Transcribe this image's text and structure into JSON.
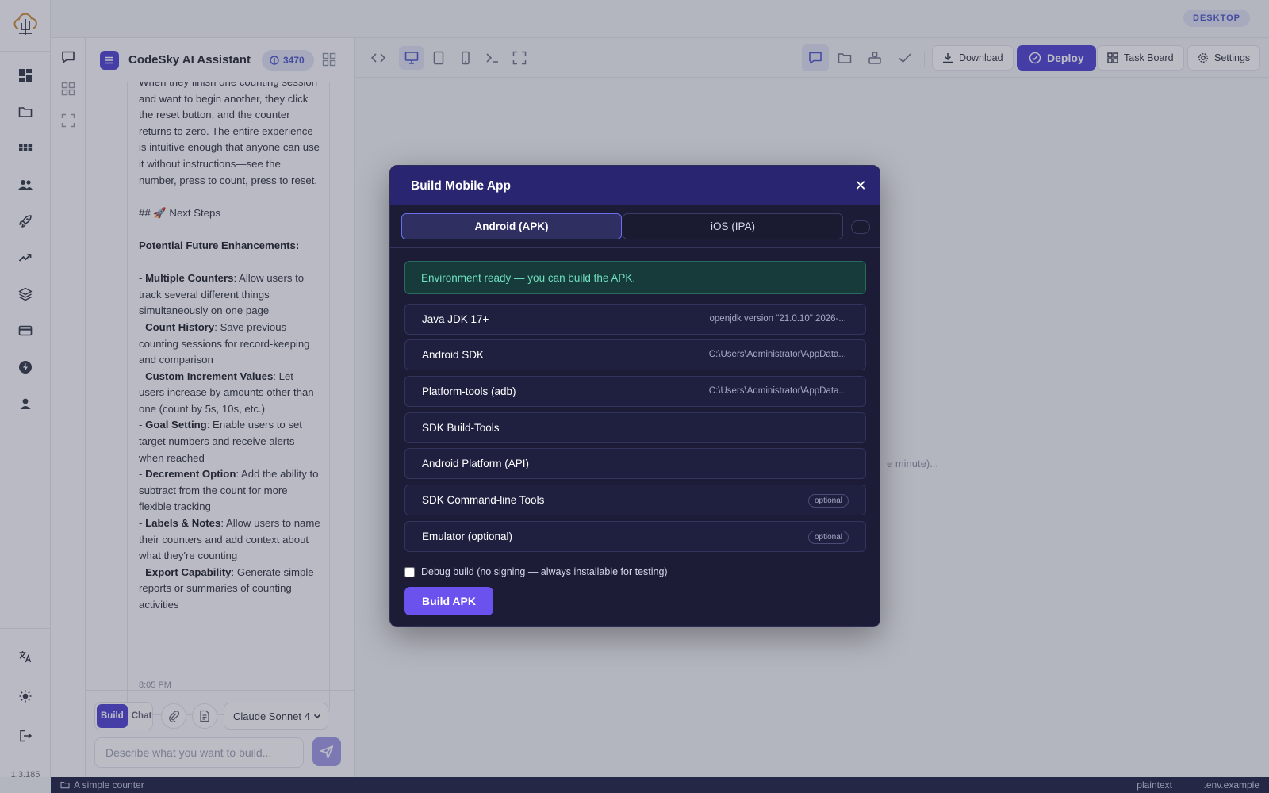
{
  "app": {
    "version": "1.3.185",
    "view_mode_pill": "DESKTOP"
  },
  "rail": {
    "icons": [
      "dashboard-icon",
      "folder-icon",
      "apps-grid-icon",
      "users-icon",
      "rocket-icon",
      "trending-icon",
      "layers-icon",
      "billing-card-icon",
      "bolt-icon",
      "profile-icon",
      "translate-icon",
      "theme-sun-icon",
      "logout-icon"
    ]
  },
  "chat": {
    "title": "CodeSky AI Assistant",
    "credits": "3470",
    "message": {
      "p1": "When they finish one counting session and want to begin another, they click the reset button, and the counter returns to zero. The entire experience is intuitive enough that anyone can use it without instructions—see the number, press to count, press to reset.",
      "heading": "## 🚀 Next Steps",
      "subheading": "Potential Future Enhancements:",
      "items": [
        {
          "title": "Multiple Counters",
          "text": ": Allow users to track several different things simultaneously on one page"
        },
        {
          "title": "Count History",
          "text": ": Save previous counting sessions for record-keeping and comparison"
        },
        {
          "title": "Custom Increment Values",
          "text": ": Let users increase by amounts other than one (count by 5s, 10s, etc.)"
        },
        {
          "title": "Goal Setting",
          "text": ": Enable users to set target numbers and receive alerts when reached"
        },
        {
          "title": "Decrement Option",
          "text": ": Add the ability to subtract from the count for more flexible tracking"
        },
        {
          "title": "Labels & Notes",
          "text": ": Allow users to name their counters and add context about what they're counting"
        },
        {
          "title": "Export Capability",
          "text": ": Generate simple reports or summaries of counting activities"
        }
      ],
      "time": "8:05 PM"
    },
    "composer": {
      "mode_build": "Build",
      "mode_chat": "Chat",
      "model": "Claude Sonnet 4",
      "placeholder": "Describe what you want to build..."
    }
  },
  "toolbar": {
    "download": "Download",
    "deploy": "Deploy",
    "task_board": "Task Board",
    "settings": "Settings"
  },
  "preview": {
    "loading_fragment": "e minute)..."
  },
  "statusbar": {
    "project": "A simple counter",
    "language": "plaintext",
    "file": ".env.example"
  },
  "modal": {
    "title": "Build Mobile App",
    "tabs": [
      "Android (APK)",
      "iOS (IPA)"
    ],
    "env_status": "Environment ready — you can build the APK.",
    "requirements": [
      {
        "name": "Java JDK 17+",
        "value": "openjdk version \"21.0.10\" 2026-...",
        "optional": ""
      },
      {
        "name": "Android SDK",
        "value": "C:\\Users\\Administrator\\AppData...",
        "optional": ""
      },
      {
        "name": "Platform-tools (adb)",
        "value": "C:\\Users\\Administrator\\AppData...",
        "optional": ""
      },
      {
        "name": "SDK Build-Tools",
        "value": "",
        "optional": ""
      },
      {
        "name": "Android Platform (API)",
        "value": "",
        "optional": ""
      },
      {
        "name": "SDK Command-line Tools",
        "value": "",
        "optional": "optional"
      },
      {
        "name": "Emulator (optional)",
        "value": "",
        "optional": "optional"
      }
    ],
    "debug_label": "Debug build (no signing — always installable for testing)",
    "debug_checked": false,
    "build_button": "Build APK"
  }
}
